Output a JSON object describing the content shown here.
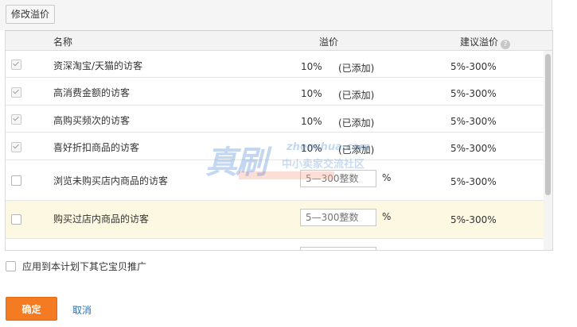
{
  "toolbar": {
    "edit_label": "修改溢价"
  },
  "table": {
    "headers": {
      "name": "名称",
      "premium": "溢价",
      "suggested": "建议溢价"
    },
    "rows": [
      {
        "checked": true,
        "name": "资深淘宝/天猫的访客",
        "premium": "10%",
        "status": "(已添加)",
        "suggested": "5%-300%"
      },
      {
        "checked": true,
        "name": "高消费金额的访客",
        "premium": "10%",
        "status": "(已添加)",
        "suggested": "5%-300%"
      },
      {
        "checked": true,
        "name": "高购买频次的访客",
        "premium": "10%",
        "status": "(已添加)",
        "suggested": "5%-300%"
      },
      {
        "checked": true,
        "name": "喜好折扣商品的访客",
        "premium": "10%",
        "status": "(已添加)",
        "suggested": "5%-300%"
      },
      {
        "checked": false,
        "name": "浏览未购买店内商品的访客",
        "placeholder": "5—300整数",
        "unit": "%",
        "suggested": "5%-300%"
      },
      {
        "checked": false,
        "name": "购买过店内商品的访客",
        "placeholder": "5—300整数",
        "unit": "%",
        "suggested": "5%-300%"
      }
    ]
  },
  "apply_label": "应用到本计划下其它宝贝推广",
  "actions": {
    "confirm": "确定",
    "cancel": "取消"
  },
  "watermark": {
    "main": "真刷",
    "url": "zhenshua.com",
    "tagline": "中小卖家交流社区"
  },
  "colors": {
    "accent": "#f47b22",
    "link": "#2a6fb8",
    "highlight_row": "#fdf8e2"
  },
  "icons": {
    "help": "question-circle-icon"
  }
}
